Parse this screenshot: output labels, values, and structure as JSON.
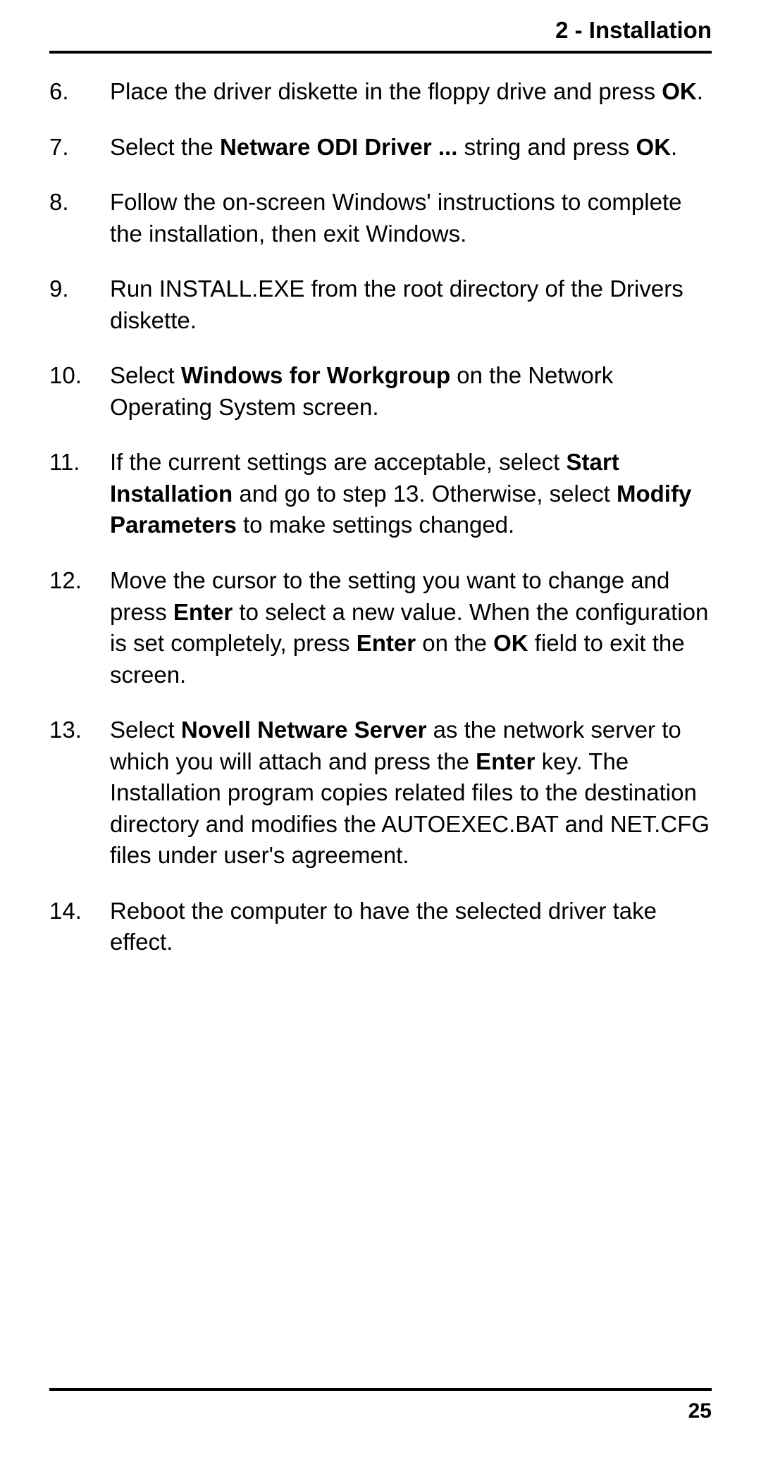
{
  "header": "2 - Installation",
  "page_number": "25",
  "items": [
    {
      "num": "6.",
      "segments": [
        {
          "t": "Place the driver diskette in the floppy drive and press ",
          "b": false
        },
        {
          "t": "OK",
          "b": true
        },
        {
          "t": ".",
          "b": false
        }
      ]
    },
    {
      "num": "7.",
      "segments": [
        {
          "t": "Select the ",
          "b": false
        },
        {
          "t": "Netware ODI Driver ...",
          "b": true
        },
        {
          "t": " string and press ",
          "b": false
        },
        {
          "t": "OK",
          "b": true
        },
        {
          "t": ".",
          "b": false
        }
      ]
    },
    {
      "num": "8.",
      "segments": [
        {
          "t": "Follow the on-screen Windows' instructions to complete the installation, then exit Windows.",
          "b": false
        }
      ]
    },
    {
      "num": "9.",
      "segments": [
        {
          "t": "Run INSTALL.EXE from the root directory of the Drivers diskette.",
          "b": false
        }
      ]
    },
    {
      "num": "10.",
      "segments": [
        {
          "t": "Select ",
          "b": false
        },
        {
          "t": "Windows for Workgroup",
          "b": true
        },
        {
          "t": " on the Network Operating System screen.",
          "b": false
        }
      ]
    },
    {
      "num": "11.",
      "segments": [
        {
          "t": "If the current settings are acceptable, select ",
          "b": false
        },
        {
          "t": "Start Installation",
          "b": true
        },
        {
          "t": " and go to step 13. Otherwise, select ",
          "b": false
        },
        {
          "t": "Modify Parameters",
          "b": true
        },
        {
          "t": " to make settings changed.",
          "b": false
        }
      ]
    },
    {
      "num": "12.",
      "segments": [
        {
          "t": "Move the cursor to the setting you want to change and press ",
          "b": false
        },
        {
          "t": "Enter",
          "b": true
        },
        {
          "t": " to select a new value. When the configuration is set completely, press ",
          "b": false
        },
        {
          "t": "Enter",
          "b": true
        },
        {
          "t": " on the ",
          "b": false
        },
        {
          "t": "OK",
          "b": true
        },
        {
          "t": " field to exit the screen.",
          "b": false
        }
      ]
    },
    {
      "num": "13.",
      "segments": [
        {
          "t": "Select ",
          "b": false
        },
        {
          "t": "Novell Netware Server",
          "b": true
        },
        {
          "t": " as the network server to which you will attach and press the ",
          "b": false
        },
        {
          "t": "Enter",
          "b": true
        },
        {
          "t": " key.  The Installation program copies related files to the destination directory and modifies the AUTOEXEC.BAT and NET.CFG files under user's agreement.",
          "b": false
        }
      ]
    },
    {
      "num": "14.",
      "segments": [
        {
          "t": "Reboot the computer to have the selected driver take effect.",
          "b": false
        }
      ]
    }
  ]
}
